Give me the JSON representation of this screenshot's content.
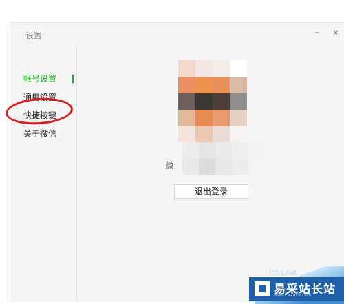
{
  "window": {
    "title": "设置",
    "minimize_glyph": "−",
    "close_glyph": "×"
  },
  "sidebar": {
    "items": [
      {
        "label": "帐号设置",
        "active": true
      },
      {
        "label": "通用设置",
        "active": false
      },
      {
        "label": "快捷按键",
        "active": false
      },
      {
        "label": "关于微信",
        "active": false
      }
    ]
  },
  "account": {
    "nickname_partial": "微",
    "logout_label": "退出登录"
  },
  "watermark": {
    "name": "易采站长站",
    "url": "Www.EasckCn.Com",
    "partial": "ib51.net"
  },
  "colors": {
    "accent": "#1aad19",
    "annotation": "#d81e1e",
    "watermark_bg": "#1f5fa8"
  },
  "icons": {
    "minimize": "minimize-icon",
    "close": "close-icon",
    "watermark_logo": "site-logo-icon"
  }
}
